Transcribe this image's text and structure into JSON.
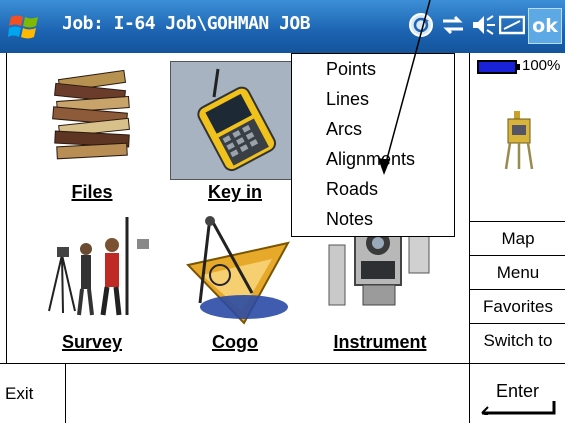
{
  "titlebar": {
    "title": "Job: I-64 Job\\GOHMAN JOB",
    "ok_label": "ok",
    "icons": [
      "windows-start-icon",
      "sync-icon",
      "connectivity-icon",
      "volume-icon",
      "keyboard-icon"
    ]
  },
  "tiles": [
    {
      "label": "Files",
      "icon": "files-icon"
    },
    {
      "label": "Key in",
      "icon": "controller-icon"
    },
    {
      "label": "Survey",
      "icon": "surveyors-icon"
    },
    {
      "label": "Cogo",
      "icon": "compass-icon"
    },
    {
      "label": "Instrument",
      "icon": "instrument-icon"
    }
  ],
  "popup_menu": {
    "items": [
      "Points",
      "Lines",
      "Arcs",
      "Alignments",
      "Roads",
      "Notes"
    ]
  },
  "status": {
    "battery_percent": "100%",
    "battery_level": 1.0
  },
  "right_buttons": [
    "Map",
    "Menu",
    "Favorites",
    "Switch to"
  ],
  "bottom": {
    "exit_label": "Exit",
    "enter_label": "Enter"
  },
  "colors": {
    "titlebar": "#1c63b1",
    "battery": "#1a22d8",
    "ok_button": "#5da9e6"
  }
}
